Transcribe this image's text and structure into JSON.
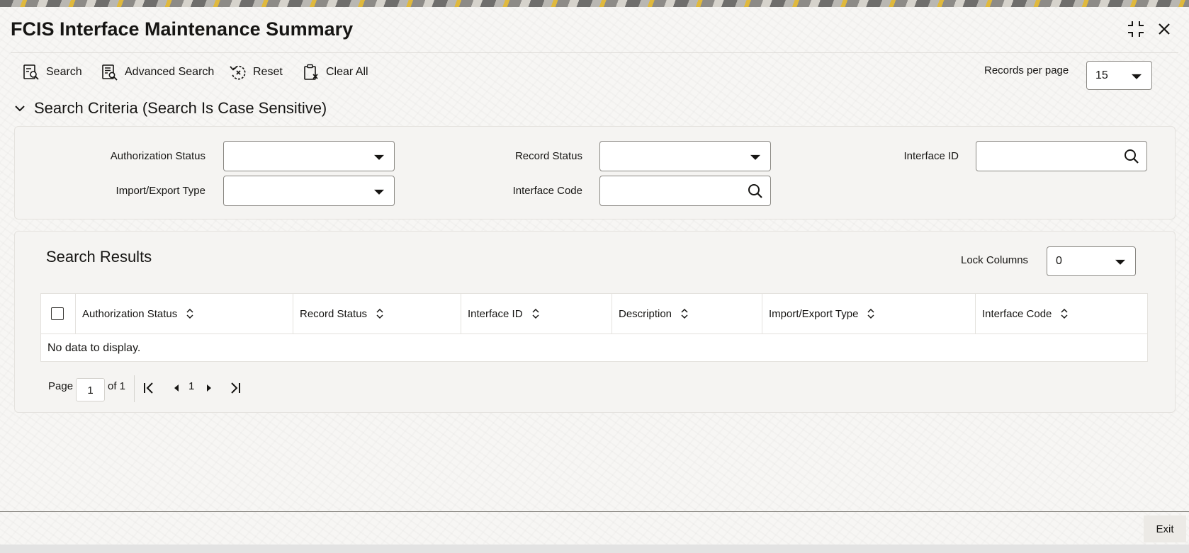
{
  "window": {
    "title": "FCIS Interface Maintenance Summary",
    "minimize_icon": "collapse-icon",
    "close_icon": "close-icon"
  },
  "toolbar": {
    "search_label": "Search",
    "advanced_search_label": "Advanced Search",
    "reset_label": "Reset",
    "clear_all_label": "Clear All",
    "records_per_page_label": "Records per page",
    "records_per_page_value": "15"
  },
  "criteria": {
    "header": "Search Criteria (Search Is Case Sensitive)",
    "authorization_status_label": "Authorization Status",
    "authorization_status_value": "",
    "record_status_label": "Record Status",
    "record_status_value": "",
    "interface_id_label": "Interface ID",
    "interface_id_value": "",
    "import_export_type_label": "Import/Export Type",
    "import_export_type_value": "",
    "interface_code_label": "Interface Code",
    "interface_code_value": ""
  },
  "results": {
    "title": "Search Results",
    "lock_columns_label": "Lock Columns",
    "lock_columns_value": "0",
    "columns": [
      "Authorization Status",
      "Record Status",
      "Interface ID",
      "Description",
      "Import/Export Type",
      "Interface Code"
    ],
    "empty_message": "No data to display."
  },
  "pagination": {
    "page_label": "Page",
    "current_page": "1",
    "of_label": "of 1",
    "page_number": "1"
  },
  "footer": {
    "exit_label": "Exit"
  },
  "colors": {
    "text": "#161513",
    "border": "#8a8883",
    "panel": "#f5f4f2"
  }
}
